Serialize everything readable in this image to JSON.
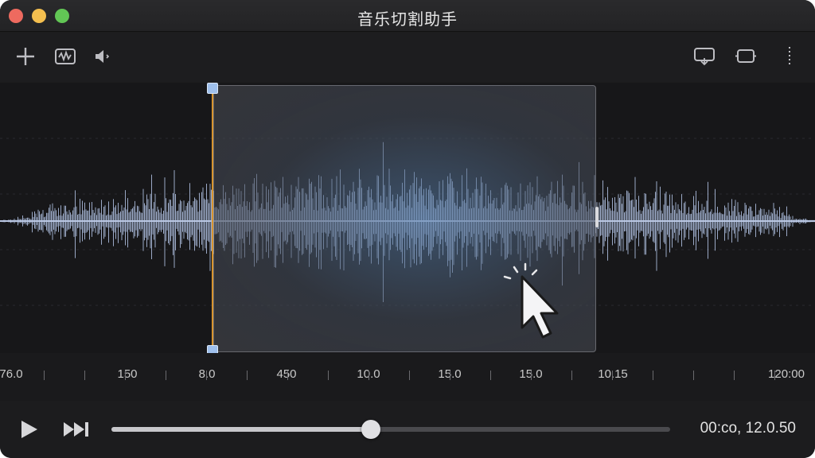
{
  "window": {
    "title": "音乐切割助手",
    "controls": [
      "close",
      "minimize",
      "maximize"
    ]
  },
  "toolbar": {
    "left_icons": [
      "add-icon",
      "waveform-edit-icon",
      "volume-icon"
    ],
    "right_icons": [
      "export-icon",
      "loop-icon",
      "more-icon"
    ]
  },
  "selection": {
    "start_fraction": 0.262,
    "end_fraction": 0.731
  },
  "timeline": {
    "labels": [
      "76.0",
      "150",
      "8.0",
      "450",
      "10.0",
      "15.0",
      "15.0",
      "10.15",
      "120:00"
    ]
  },
  "transport": {
    "progress": 0.465,
    "time_readout": "00:co, 12.0.50"
  },
  "colors": {
    "accent": "#d8952f",
    "waveform": "#a9b8d8",
    "handle": "#9fc0ec",
    "background": "#1c1c1d"
  }
}
